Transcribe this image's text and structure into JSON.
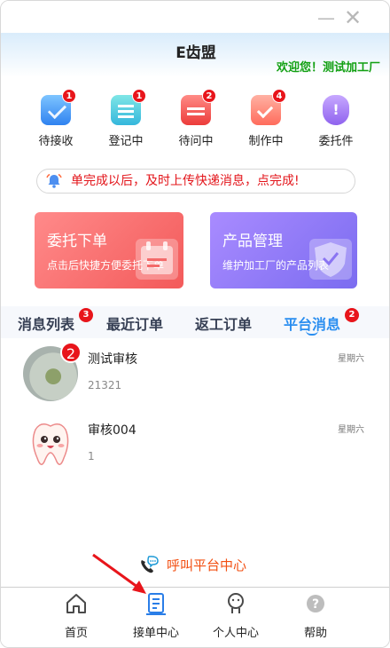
{
  "window": {
    "minimize_label": "—",
    "close_label": "✕"
  },
  "header": {
    "app_title": "E齿盟",
    "welcome": "欢迎您！测试加工厂"
  },
  "status_items": [
    {
      "label": "待接收",
      "badge": "1",
      "icon": "inbox-envelope-icon"
    },
    {
      "label": "登记中",
      "badge": "1",
      "icon": "register-form-icon"
    },
    {
      "label": "待问中",
      "badge": "2",
      "icon": "inquiry-calendar-icon"
    },
    {
      "label": "制作中",
      "badge": "4",
      "icon": "production-check-icon"
    },
    {
      "label": "委托件",
      "badge": "",
      "icon": "entrust-shield-icon"
    }
  ],
  "notice": {
    "text": "单完成以后，及时上传快递消息，点完成!",
    "icon": "bell-icon"
  },
  "cards": [
    {
      "title": "委托下单",
      "subtitle": "点击后快捷方便委托下单",
      "icon": "calendar-icon"
    },
    {
      "title": "产品管理",
      "subtitle": "维护加工厂的产品列表",
      "icon": "shield-icon"
    }
  ],
  "tabs": [
    {
      "label": "消息列表",
      "badge": "3"
    },
    {
      "label": "最近订单",
      "badge": ""
    },
    {
      "label": "返工订单",
      "badge": ""
    },
    {
      "label": "平台消息",
      "badge": "2",
      "active": true
    }
  ],
  "messages": [
    {
      "name": "测试审核",
      "preview": "21321",
      "time": "星期六",
      "badge": "2"
    },
    {
      "name": "审核004",
      "preview": "1",
      "time": "星期六",
      "badge": ""
    }
  ],
  "call_center": {
    "label": "呼叫平台中心",
    "icon": "phone-chat-icon"
  },
  "bottom_nav": [
    {
      "label": "首页",
      "icon": "home-icon"
    },
    {
      "label": "接单中心",
      "icon": "order-document-icon"
    },
    {
      "label": "个人中心",
      "icon": "person-icon"
    },
    {
      "label": "帮助",
      "icon": "help-icon"
    }
  ],
  "colors": {
    "accent_blue": "#2a8ef0",
    "badge_red": "#e8151b",
    "welcome_green": "#12a012",
    "notice_red": "#e3141a",
    "call_orange": "#f24f12"
  }
}
